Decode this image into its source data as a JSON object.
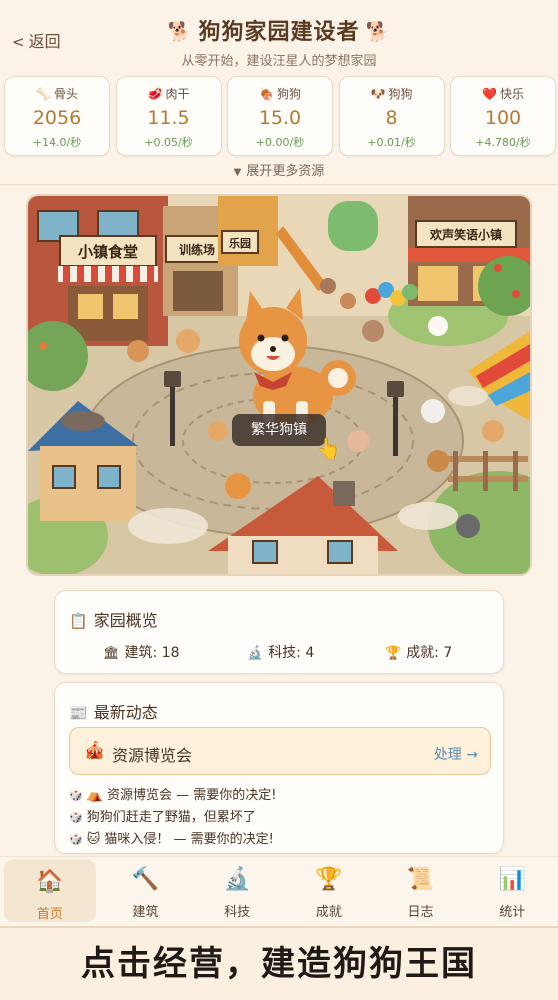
{
  "header": {
    "back_label": "返回",
    "title": "狗狗家园建设者",
    "title_icon": "🐕",
    "subtitle": "从零开始，建设汪星人的梦想家园"
  },
  "resources": [
    {
      "icon": "🦴",
      "icon_name": "bone-icon",
      "name": "骨头",
      "value": "2056",
      "rate": "+14.0/秒"
    },
    {
      "icon": "🥩",
      "icon_name": "jerky-icon",
      "name": "肉干",
      "value": "11.5",
      "rate": "+0.05/秒"
    },
    {
      "icon": "🍖",
      "icon_name": "meat-icon",
      "name": "狗狗",
      "value": "15.0",
      "rate": "+0.00/秒"
    },
    {
      "icon": "🐶",
      "icon_name": "dog-face-icon",
      "name": "狗狗",
      "value": "8",
      "rate": "+0.01/秒"
    },
    {
      "icon": "❤️",
      "icon_name": "heart-icon",
      "name": "快乐",
      "value": "100",
      "rate": "+4.780/秒"
    }
  ],
  "expand_label": "展开更多资源",
  "scene": {
    "signs": {
      "diner": "小镇食堂",
      "training": "训练场",
      "park": "乐园",
      "joke_town": "欢声笑语小镇"
    },
    "town_name": "繁华狗镇"
  },
  "overview": {
    "title": "家园概览",
    "stats": [
      {
        "icon": "🏛",
        "icon_name": "building-icon",
        "text": "建筑: 18"
      },
      {
        "icon": "🔬",
        "icon_name": "microscope-icon",
        "text": "科技: 4"
      },
      {
        "icon": "🏆",
        "icon_name": "trophy-icon",
        "text": "成就: 7"
      }
    ]
  },
  "news": {
    "title": "最新动态",
    "event": {
      "icon": "🎪",
      "title": "资源博览会",
      "action": "处理 →"
    },
    "lines": [
      "⛺ 资源博览会 — 需要你的决定!",
      "狗狗们赶走了野猫，但累坏了",
      "🐱 猫咪入侵！ — 需要你的决定!"
    ]
  },
  "nav": [
    {
      "icon": "🏠",
      "icon_name": "home-icon",
      "label": "首页",
      "active": true
    },
    {
      "icon": "🔨",
      "icon_name": "hammer-icon",
      "label": "建筑",
      "active": false
    },
    {
      "icon": "🔬",
      "icon_name": "microscope-icon",
      "label": "科技",
      "active": false
    },
    {
      "icon": "🏆",
      "icon_name": "trophy-icon",
      "label": "成就",
      "active": false
    },
    {
      "icon": "📜",
      "icon_name": "scroll-icon",
      "label": "日志",
      "active": false
    },
    {
      "icon": "📊",
      "icon_name": "chart-icon",
      "label": "统计",
      "active": false
    }
  ],
  "banner": "点击经营，建造狗狗王国",
  "colors": {
    "background": "#fbf3e8",
    "resource_value": "#b47b35",
    "rate_green": "#6a9a58",
    "action_blue": "#5b8fb3",
    "nav_active": "#c97a2c"
  }
}
